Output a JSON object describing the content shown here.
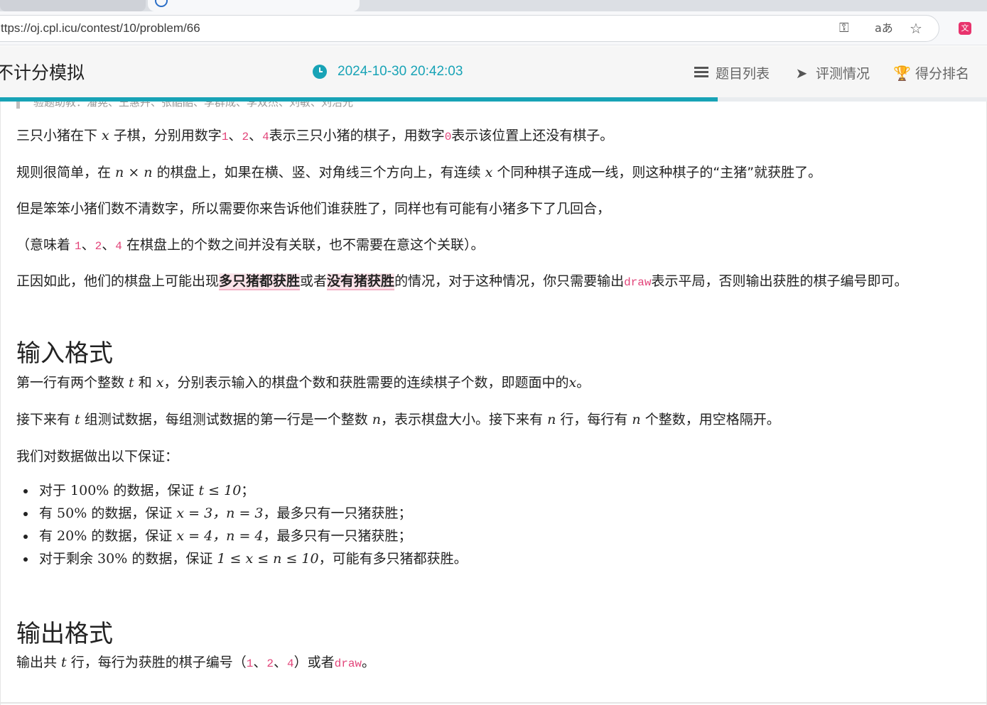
{
  "browser": {
    "url": "ttps://oj.cpl.icu/contest/10/problem/66",
    "icons": [
      "key-icon",
      "read-aloud-icon",
      "favorite-star-icon",
      "translate-extension-icon"
    ]
  },
  "header": {
    "contest_title": "不计分模拟",
    "timer": "2024-10-30 20:42:03",
    "nav": {
      "problems": "题目列表",
      "status": "评测情况",
      "ranking": "得分排名"
    },
    "progress_fraction": 0.727,
    "accent_color": "#18a3b6"
  },
  "problem": {
    "quote": "验题助教：潘晃、王惠卉、张酷酷、李群成、李双杰、刘敏、刘治光",
    "p1": {
      "a": "三只小猪在下 ",
      "var": "x",
      "b": " 子棋，分别用数字",
      "c1": "1",
      "sep1": "、",
      "c2": "2",
      "sep2": "、",
      "c4": "4",
      "d": "表示三只小猪的棋子，用数字",
      "c0": "0",
      "e": "表示该位置上还没有棋子。"
    },
    "p2": {
      "a": "规则很简单，在 ",
      "n1": "n",
      "times": " × ",
      "n2": "n",
      "b": " 的棋盘上，如果在横、竖、对角线三个方向上，有连续 ",
      "x": "x",
      "c": " 个同种棋子连成一线，则这种棋子的“主猪”就获胜了。"
    },
    "p3": "但是笨笨小猪们数不清数字，所以需要你来告诉他们谁获胜了，同样也有可能有小猪多下了几回合，",
    "p4": {
      "a": "（意味着 ",
      "c1": "1",
      "sep1": "、",
      "c2": "2",
      "sep2": "、",
      "c4": "4",
      "b": " 在棋盘上的个数之间并没有关联，也不需要在意这个关联）。"
    },
    "p5": {
      "a": "正因如此，他们的棋盘上可能出现",
      "s1": "多只猪都获胜",
      "b": "或者",
      "s2": "没有猪获胜",
      "c": "的情况，对于这种情况，你只需要输出",
      "code": "draw",
      "d": "表示平局，否则输出获胜的棋子编号即可。"
    },
    "input_heading": "输入格式",
    "in1": {
      "a": "第一行有两个整数 ",
      "t": "t",
      "b": " 和 ",
      "x": "x",
      "c": "，分别表示输入的棋盘个数和获胜需要的连续棋子个数，即题面中的",
      "x2": "x",
      "d": "。"
    },
    "in2": {
      "a": "接下来有 ",
      "t": "t",
      "b": " 组测试数据，每组测试数据的第一行是一个整数 ",
      "n1": "n",
      "c": "，表示棋盘大小。接下来有 ",
      "n2": "n",
      "d": " 行，每行有 ",
      "n3": "n",
      "e": " 个整数，用空格隔开。"
    },
    "in3": "我们对数据做出以下保证：",
    "constraints": [
      {
        "a": "对于 ",
        "pct": "100%",
        "b": " 的数据，保证 ",
        "m": "t ≤ 10",
        "c": "；"
      },
      {
        "a": "有 ",
        "pct": "50%",
        "b": " 的数据，保证 ",
        "m": "x = 3，n = 3",
        "c": "，最多只有一只猪获胜；"
      },
      {
        "a": "有 ",
        "pct": "20%",
        "b": " 的数据，保证 ",
        "m": "x = 4，n = 4",
        "c": "，最多只有一只猪获胜；"
      },
      {
        "a": "对于剩余 ",
        "pct": "30%",
        "b": " 的数据，保证 ",
        "m": "1 ≤ x ≤ n ≤ 10",
        "c": "，可能有多只猪都获胜。"
      }
    ],
    "output_heading": "输出格式",
    "out1": {
      "a": "输出共 ",
      "t": "t",
      "b": " 行，每行为获胜的棋子编号（",
      "c1": "1",
      "sep1": "、",
      "c2": "2",
      "sep2": "、",
      "c4": "4",
      "c": "）或者",
      "code": "draw",
      "d": "。"
    }
  }
}
